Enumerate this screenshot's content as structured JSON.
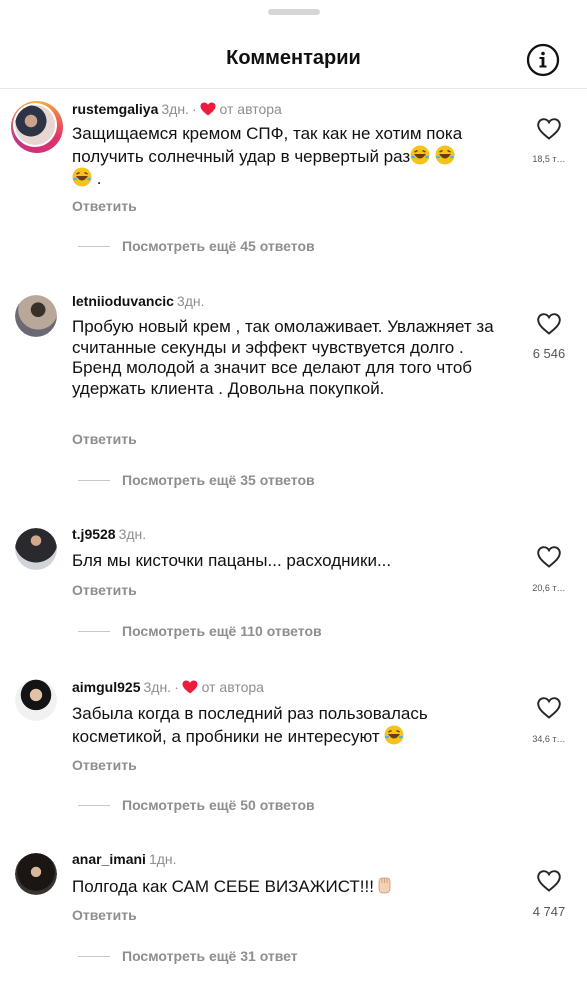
{
  "header": {
    "title": "Комментарии"
  },
  "comments": [
    {
      "user": "rustemgaliya",
      "time": "3дн.",
      "dot": "·",
      "by_author": "от автора",
      "text": "Защищаемся кремом СПФ, так как не хотим пока получить солнечный удар в червертый раз",
      "text_tail": ".",
      "emoji_count": 3,
      "reply": "Ответить",
      "more": "Посмотреть ещё 45 ответов",
      "likes": "18,5 т…"
    },
    {
      "user": "letniioduvancic",
      "time": "3дн.",
      "text": "Пробую новый крем , так омолаживает. Увлажняет за считанные секунды и эффект чувствуется долго . Бренд молодой а значит все делают для того чтоб удержать клиента . Довольна покупкой.",
      "reply": "Ответить",
      "more": "Посмотреть ещё 35 ответов",
      "likes": "6 546"
    },
    {
      "user": "t.j9528",
      "time": "3дн.",
      "text": "Бля мы кисточки пацаны... расходники...",
      "reply": "Ответить",
      "more": "Посмотреть ещё 110 ответов",
      "likes": "20,6 т…"
    },
    {
      "user": "aimgul925",
      "time": "3дн.",
      "dot": "·",
      "by_author": "от автора",
      "text": "Забыла когда в последний раз пользовалась косметикой, а пробники не интересуют",
      "reply": "Ответить",
      "more": "Посмотреть ещё 50 ответов",
      "likes": "34,6 т…"
    },
    {
      "user": "anar_imani",
      "time": "1дн.",
      "text": "Полгода как САМ СЕБЕ ВИЗАЖИСТ!!!",
      "reply": "Ответить",
      "more": "Посмотреть ещё 31 ответ",
      "likes": "4 747"
    }
  ],
  "colors": {
    "heart_red": "#ed1c3c",
    "muted": "#8e8e8e"
  },
  "icons": [
    "info-icon",
    "heart-outline-icon",
    "heart-filled-icon",
    "laughing-emoji",
    "raised-fist-emoji"
  ]
}
